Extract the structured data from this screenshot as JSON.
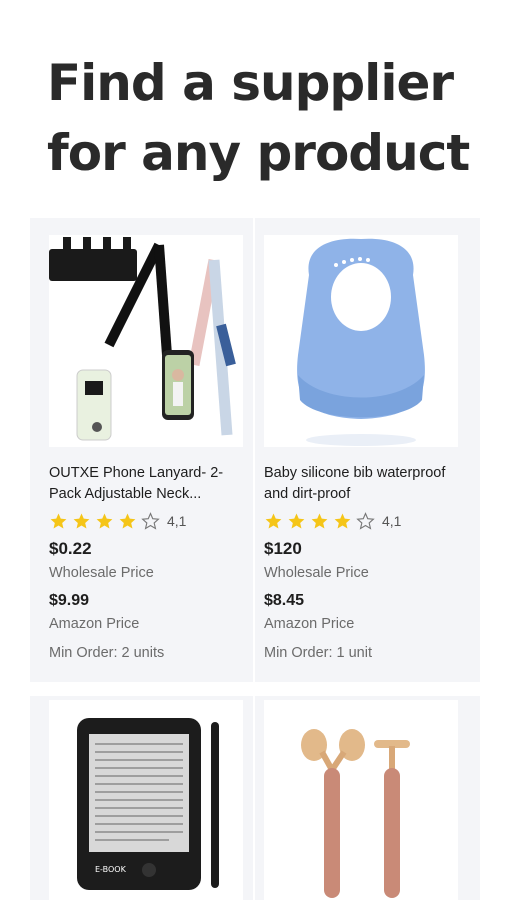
{
  "hero": {
    "line1": "Find a supplier",
    "line2": "for any product"
  },
  "products": [
    {
      "title": "OUTXE Phone Lanyard- 2-Pack Adjustable Neck...",
      "rating": "4,1",
      "wholesale_price": "$0.22",
      "wholesale_label": "Wholesale Price",
      "amazon_price": "$9.99",
      "amazon_label": "Amazon Price",
      "min_order": "Min Order: 2 units",
      "icon": "phone-lanyard-image"
    },
    {
      "title": "Baby silicone bib waterproof and dirt-proof",
      "rating": "4,1",
      "wholesale_price": "$120",
      "wholesale_label": "Wholesale Price",
      "amazon_price": "$8.45",
      "amazon_label": "Amazon Price",
      "min_order": "Min Order: 1 unit",
      "icon": "baby-bib-image"
    },
    {
      "icon": "ebook-reader-image",
      "screen_brand": "E-BOOK"
    },
    {
      "icon": "face-roller-image"
    }
  ],
  "colors": {
    "star": "#f5c518",
    "bib": "#8fb3e8",
    "roller": "#c98a77"
  }
}
